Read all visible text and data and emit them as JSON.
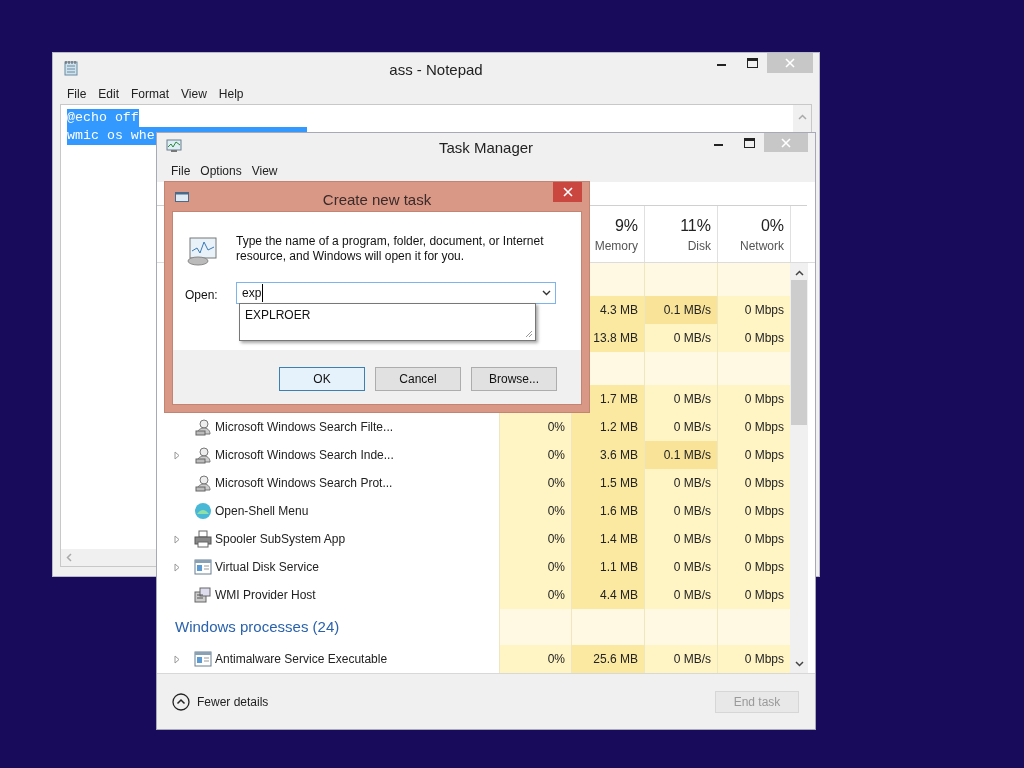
{
  "notepad": {
    "title": "ass - Notepad",
    "menu": [
      "File",
      "Edit",
      "Format",
      "View",
      "Help"
    ],
    "lines": [
      {
        "text": "@echo off",
        "selected": true
      },
      {
        "text": "wmic os whe",
        "selected": true
      }
    ]
  },
  "task_manager": {
    "title": "Task Manager",
    "menu": [
      "File",
      "Options",
      "View"
    ],
    "columns": [
      {
        "percent": "9%",
        "label": "Memory"
      },
      {
        "percent": "11%",
        "label": "Disk"
      },
      {
        "percent": "0%",
        "label": "Network"
      }
    ],
    "rows": [
      {
        "kind": "spacer"
      },
      {
        "kind": "process",
        "memory": "4.3 MB",
        "disk": "0.1 MB/s",
        "network": "0 Mbps",
        "disk_busy": true
      },
      {
        "kind": "process",
        "memory": "13.8 MB",
        "disk": "0 MB/s",
        "network": "0 Mbps",
        "disk_busy": false
      },
      {
        "kind": "spacer"
      },
      {
        "kind": "process",
        "memory": "1.7 MB",
        "disk": "0 MB/s",
        "network": "0 Mbps",
        "disk_busy": false
      },
      {
        "kind": "process",
        "name": "Microsoft Windows Search Filte...",
        "expandable": false,
        "cpu": "0%",
        "memory": "1.2 MB",
        "disk": "0 MB/s",
        "network": "0 Mbps",
        "disk_busy": false
      },
      {
        "kind": "process",
        "name": "Microsoft Windows Search Inde...",
        "expandable": true,
        "cpu": "0%",
        "memory": "3.6 MB",
        "disk": "0.1 MB/s",
        "network": "0 Mbps",
        "disk_busy": true
      },
      {
        "kind": "process",
        "name": "Microsoft Windows Search Prot...",
        "expandable": false,
        "cpu": "0%",
        "memory": "1.5 MB",
        "disk": "0 MB/s",
        "network": "0 Mbps",
        "disk_busy": false
      },
      {
        "kind": "process",
        "name": "Open-Shell Menu",
        "expandable": false,
        "cpu": "0%",
        "memory": "1.6 MB",
        "disk": "0 MB/s",
        "network": "0 Mbps",
        "disk_busy": false
      },
      {
        "kind": "process",
        "name": "Spooler SubSystem App",
        "expandable": true,
        "cpu": "0%",
        "memory": "1.4 MB",
        "disk": "0 MB/s",
        "network": "0 Mbps",
        "disk_busy": false
      },
      {
        "kind": "process",
        "name": "Virtual Disk Service",
        "expandable": true,
        "cpu": "0%",
        "memory": "1.1 MB",
        "disk": "0 MB/s",
        "network": "0 Mbps",
        "disk_busy": false
      },
      {
        "kind": "process",
        "name": "WMI Provider Host",
        "expandable": false,
        "cpu": "0%",
        "memory": "4.4 MB",
        "disk": "0 MB/s",
        "network": "0 Mbps",
        "disk_busy": false
      },
      {
        "kind": "group",
        "name": "Windows processes (24)"
      },
      {
        "kind": "process",
        "name": "Antimalware Service Executable",
        "expandable": true,
        "cpu": "0%",
        "memory": "25.6 MB",
        "disk": "0 MB/s",
        "network": "0 Mbps",
        "disk_busy": false
      }
    ],
    "footer": {
      "toggle": "Fewer details",
      "end_task": {
        "label": "End task",
        "disabled": true
      }
    }
  },
  "dialog": {
    "title": "Create new task",
    "message": [
      "Type the name of a program, folder, document, or Internet",
      "resource, and Windows will open it for you."
    ],
    "open_label": "Open:",
    "open_value": "exp",
    "suggestions": [
      "EXPLROER"
    ],
    "buttons": [
      {
        "label": "OK",
        "default": true
      },
      {
        "label": "Cancel",
        "default": false
      },
      {
        "label": "Browse...",
        "default": false
      }
    ]
  }
}
